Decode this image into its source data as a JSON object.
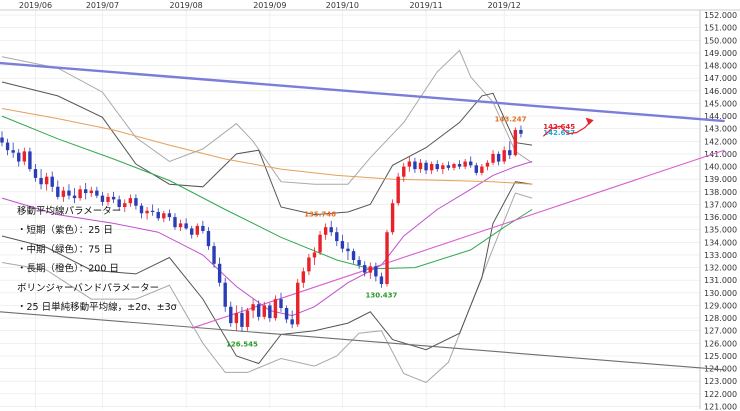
{
  "chart_data": {
    "type": "candlestick",
    "x_ticks": [
      "2019/06",
      "2019/07",
      "2019/08",
      "2019/09",
      "2019/10",
      "2019/11",
      "2019/12"
    ],
    "y_ticks": [
      121,
      122,
      123,
      124,
      125,
      126,
      127,
      128,
      129,
      130,
      131,
      132,
      133,
      134,
      135,
      136,
      137,
      138,
      139,
      140,
      141,
      142,
      143,
      144,
      145,
      146,
      147,
      148,
      149,
      150,
      151,
      152
    ],
    "y_tick_labels": [
      "121.000",
      "122.000",
      "123.000",
      "124.000",
      "125.000",
      "126.000",
      "127.000",
      "128.000",
      "129.000",
      "130.000",
      "131.000",
      "132.000",
      "133.000",
      "134.000",
      "135.000",
      "136.000",
      "137.000",
      "138.000",
      "139.000",
      "140.000",
      "141.000",
      "142.000",
      "143.000",
      "144.000",
      "145.000",
      "146.000",
      "147.000",
      "148.000",
      "149.000",
      "150.000",
      "151.000",
      "152.000"
    ],
    "ylim": [
      120.8,
      152.4
    ],
    "y_axis_side": "right",
    "grid": true,
    "up_color": "#e8212b",
    "down_color": "#2a3db5",
    "candles": [
      [
        142.3,
        142.8,
        141.6,
        141.9
      ],
      [
        141.9,
        142.2,
        140.9,
        141.3
      ],
      [
        141.3,
        141.9,
        140.7,
        141.1
      ],
      [
        141.1,
        141.4,
        140.0,
        140.4
      ],
      [
        140.4,
        141.5,
        140.1,
        141.2
      ],
      [
        141.2,
        141.5,
        139.6,
        139.8
      ],
      [
        139.8,
        140.2,
        138.8,
        139.1
      ],
      [
        139.1,
        139.8,
        138.2,
        138.6
      ],
      [
        138.6,
        139.5,
        138.1,
        139.2
      ],
      [
        139.2,
        139.6,
        138.0,
        138.4
      ],
      [
        138.4,
        138.9,
        137.4,
        137.6
      ],
      [
        137.6,
        138.4,
        137.2,
        138.1
      ],
      [
        138.1,
        138.6,
        137.4,
        137.7
      ],
      [
        137.7,
        138.3,
        137.1,
        137.5
      ],
      [
        137.5,
        138.5,
        137.3,
        138.2
      ],
      [
        138.2,
        138.7,
        137.4,
        137.9
      ],
      [
        137.9,
        138.4,
        137.6,
        138.1
      ],
      [
        138.1,
        138.4,
        137.5,
        137.7
      ],
      [
        137.7,
        138.0,
        136.9,
        137.2
      ],
      [
        137.2,
        137.9,
        136.9,
        137.6
      ],
      [
        137.6,
        138.0,
        137.1,
        137.4
      ],
      [
        137.4,
        137.7,
        136.5,
        136.8
      ],
      [
        136.8,
        137.4,
        136.4,
        137.1
      ],
      [
        137.1,
        137.8,
        136.8,
        137.5
      ],
      [
        137.5,
        137.8,
        136.6,
        136.9
      ],
      [
        136.9,
        137.1,
        135.9,
        136.3
      ],
      [
        136.3,
        136.8,
        135.8,
        136.5
      ],
      [
        136.5,
        137.0,
        136.1,
        136.4
      ],
      [
        136.4,
        136.7,
        135.7,
        135.9
      ],
      [
        135.9,
        136.5,
        135.6,
        136.3
      ],
      [
        136.3,
        136.6,
        135.7,
        136.0
      ],
      [
        136.0,
        136.3,
        135.0,
        135.2
      ],
      [
        135.2,
        135.8,
        134.9,
        135.5
      ],
      [
        135.5,
        135.9,
        135.0,
        135.1
      ],
      [
        135.1,
        135.3,
        134.3,
        134.6
      ],
      [
        134.6,
        135.5,
        134.4,
        135.3
      ],
      [
        135.3,
        135.7,
        134.7,
        134.9
      ],
      [
        134.9,
        135.2,
        133.4,
        133.7
      ],
      [
        133.7,
        134.0,
        132.0,
        132.3
      ],
      [
        132.3,
        132.8,
        130.5,
        130.8
      ],
      [
        130.8,
        131.2,
        128.5,
        128.9
      ],
      [
        128.9,
        129.3,
        127.3,
        127.6
      ],
      [
        127.6,
        129.0,
        127.0,
        128.4
      ],
      [
        128.4,
        128.9,
        126.9,
        127.3
      ],
      [
        127.3,
        128.8,
        127.0,
        128.6
      ],
      [
        128.6,
        129.5,
        128.0,
        129.1
      ],
      [
        129.1,
        129.4,
        127.8,
        128.1
      ],
      [
        128.1,
        129.3,
        127.9,
        129.0
      ],
      [
        129.0,
        129.2,
        127.7,
        128.0
      ],
      [
        128.0,
        129.8,
        127.8,
        129.5
      ],
      [
        129.5,
        130.0,
        128.5,
        128.8
      ],
      [
        128.8,
        129.0,
        127.6,
        127.9
      ],
      [
        127.9,
        128.6,
        127.2,
        127.5
      ],
      [
        127.5,
        131.1,
        127.3,
        130.8
      ],
      [
        130.8,
        132.0,
        130.4,
        131.7
      ],
      [
        131.7,
        133.1,
        131.4,
        132.8
      ],
      [
        132.8,
        133.6,
        132.2,
        133.2
      ],
      [
        133.2,
        134.9,
        133.0,
        134.6
      ],
      [
        134.6,
        135.5,
        134.2,
        135.2
      ],
      [
        135.2,
        135.7,
        134.5,
        134.8
      ],
      [
        134.8,
        135.2,
        133.7,
        134.1
      ],
      [
        134.1,
        134.6,
        133.2,
        133.5
      ],
      [
        133.5,
        134.0,
        132.6,
        133.3
      ],
      [
        133.3,
        133.5,
        132.3,
        132.6
      ],
      [
        132.6,
        132.9,
        131.9,
        132.2
      ],
      [
        132.2,
        132.5,
        131.3,
        131.6
      ],
      [
        131.6,
        132.4,
        131.1,
        132.1
      ],
      [
        132.1,
        132.4,
        130.9,
        131.3
      ],
      [
        131.3,
        131.6,
        130.4,
        130.7
      ],
      [
        130.7,
        135.0,
        130.5,
        134.8
      ],
      [
        134.8,
        137.4,
        134.6,
        137.1
      ],
      [
        137.1,
        139.5,
        136.9,
        139.2
      ],
      [
        139.2,
        140.3,
        138.8,
        140.0
      ],
      [
        140.0,
        140.8,
        139.6,
        140.4
      ],
      [
        140.4,
        140.7,
        139.5,
        139.8
      ],
      [
        139.8,
        140.6,
        139.5,
        140.3
      ],
      [
        140.3,
        140.5,
        139.4,
        139.7
      ],
      [
        139.7,
        140.4,
        139.4,
        140.2
      ],
      [
        140.2,
        140.5,
        139.6,
        139.8
      ],
      [
        139.8,
        140.3,
        139.4,
        140.1
      ],
      [
        140.1,
        140.4,
        139.7,
        139.9
      ],
      [
        139.9,
        140.3,
        139.7,
        140.2
      ],
      [
        140.2,
        140.5,
        139.8,
        140.0
      ],
      [
        140.0,
        140.6,
        139.8,
        140.4
      ],
      [
        140.4,
        140.8,
        139.9,
        140.1
      ],
      [
        140.1,
        140.3,
        139.3,
        139.5
      ],
      [
        139.5,
        140.2,
        139.3,
        140.0
      ],
      [
        140.0,
        140.5,
        139.7,
        140.3
      ],
      [
        140.3,
        141.3,
        140.1,
        141.0
      ],
      [
        141.0,
        141.2,
        140.1,
        140.4
      ],
      [
        140.4,
        141.6,
        140.2,
        141.3
      ],
      [
        141.3,
        142.0,
        140.6,
        140.9
      ],
      [
        140.9,
        143.1,
        140.8,
        142.9
      ],
      [
        142.9,
        143.25,
        142.3,
        142.6
      ]
    ],
    "moving_averages": [
      {
        "color": "#c050d0",
        "points": [
          [
            0,
            137.5
          ],
          [
            10,
            136.2
          ],
          [
            20,
            135.5
          ],
          [
            28,
            134.8
          ],
          [
            36,
            133.0
          ],
          [
            42,
            130.5
          ],
          [
            48,
            128.6
          ],
          [
            52,
            128.2
          ],
          [
            56,
            128.9
          ],
          [
            62,
            130.8
          ],
          [
            68,
            132.2
          ],
          [
            72,
            134.5
          ],
          [
            78,
            136.6
          ],
          [
            84,
            138.2
          ],
          [
            88,
            139.3
          ],
          [
            92,
            140.0
          ],
          [
            95,
            140.4
          ]
        ]
      },
      {
        "color": "#2fa84f",
        "points": [
          [
            0,
            144.0
          ],
          [
            10,
            142.2
          ],
          [
            20,
            140.6
          ],
          [
            30,
            138.9
          ],
          [
            40,
            136.6
          ],
          [
            50,
            134.4
          ],
          [
            60,
            132.6
          ],
          [
            66,
            131.9
          ],
          [
            74,
            132.0
          ],
          [
            84,
            133.4
          ],
          [
            90,
            135.2
          ],
          [
            95,
            136.6
          ]
        ]
      },
      {
        "color": "#e5a058",
        "points": [
          [
            0,
            144.6
          ],
          [
            10,
            143.8
          ],
          [
            20,
            142.9
          ],
          [
            30,
            141.7
          ],
          [
            40,
            140.6
          ],
          [
            50,
            139.8
          ],
          [
            60,
            139.3
          ],
          [
            70,
            139.0
          ],
          [
            80,
            138.9
          ],
          [
            88,
            138.8
          ],
          [
            95,
            138.6
          ]
        ]
      }
    ],
    "bollinger_bands": [
      {
        "sigma": "±2σ",
        "color": "#555555",
        "upper": [
          [
            0,
            146.7
          ],
          [
            10,
            145.6
          ],
          [
            18,
            143.9
          ],
          [
            24,
            140.2
          ],
          [
            30,
            138.6
          ],
          [
            36,
            138.4
          ],
          [
            42,
            141.0
          ],
          [
            46,
            141.3
          ],
          [
            50,
            136.8
          ],
          [
            56,
            136.2
          ],
          [
            62,
            136.4
          ],
          [
            66,
            137.0
          ],
          [
            70,
            140.1
          ],
          [
            76,
            141.5
          ],
          [
            82,
            143.5
          ],
          [
            86,
            145.6
          ],
          [
            88,
            145.8
          ],
          [
            92,
            141.9
          ],
          [
            95,
            141.7
          ]
        ],
        "lower": [
          [
            0,
            134.5
          ],
          [
            8,
            133.6
          ],
          [
            16,
            131.8
          ],
          [
            24,
            131.5
          ],
          [
            30,
            132.8
          ],
          [
            36,
            129.5
          ],
          [
            42,
            125.0
          ],
          [
            46,
            124.4
          ],
          [
            50,
            126.7
          ],
          [
            56,
            127.0
          ],
          [
            62,
            127.6
          ],
          [
            66,
            128.5
          ],
          [
            70,
            126.3
          ],
          [
            76,
            125.5
          ],
          [
            82,
            126.8
          ],
          [
            86,
            131.2
          ],
          [
            88,
            135.5
          ],
          [
            92,
            138.8
          ],
          [
            95,
            138.6
          ]
        ]
      },
      {
        "sigma": "±3σ",
        "color": "#a8a8a8",
        "upper": [
          [
            0,
            148.7
          ],
          [
            10,
            147.8
          ],
          [
            18,
            145.9
          ],
          [
            24,
            142.3
          ],
          [
            30,
            140.4
          ],
          [
            36,
            141.4
          ],
          [
            42,
            143.4
          ],
          [
            45,
            142.0
          ],
          [
            50,
            138.8
          ],
          [
            56,
            138.6
          ],
          [
            62,
            138.6
          ],
          [
            66,
            140.7
          ],
          [
            72,
            143.5
          ],
          [
            78,
            147.5
          ],
          [
            82,
            149.2
          ],
          [
            84,
            147.1
          ],
          [
            88,
            145.1
          ],
          [
            92,
            141.2
          ],
          [
            95,
            140.3
          ]
        ],
        "lower": [
          [
            0,
            132.4
          ],
          [
            8,
            131.8
          ],
          [
            16,
            129.5
          ],
          [
            24,
            129.5
          ],
          [
            30,
            130.6
          ],
          [
            36,
            126.0
          ],
          [
            40,
            123.7
          ],
          [
            44,
            123.7
          ],
          [
            50,
            124.8
          ],
          [
            56,
            124.2
          ],
          [
            60,
            125.0
          ],
          [
            64,
            126.8
          ],
          [
            68,
            127.0
          ],
          [
            72,
            123.6
          ],
          [
            76,
            122.9
          ],
          [
            80,
            124.5
          ],
          [
            84,
            129.0
          ],
          [
            88,
            133.5
          ],
          [
            92,
            137.9
          ],
          [
            95,
            137.5
          ]
        ]
      }
    ],
    "trend_lines": [
      {
        "color": "#7b7ddb",
        "from": [
          -0.5,
          148.2
        ],
        "to": [
          129.5,
          143.6
        ],
        "width": 2.4
      },
      {
        "color": "#6e6e6e",
        "from": [
          -0.5,
          128.5
        ],
        "to": [
          129.5,
          123.9
        ],
        "width": 1.1
      },
      {
        "color": "#d860d0",
        "from": [
          34,
          127.2
        ],
        "to": [
          129.5,
          141.3
        ],
        "width": 1.1
      }
    ],
    "annotations": [
      {
        "text": "143.247",
        "at": [
          94,
          143.25
        ],
        "color": "#e07020",
        "anchor": "end"
      },
      {
        "text": "142.645",
        "at": [
          97,
          142.645
        ],
        "color": "#e8212b",
        "anchor": "start"
      },
      {
        "text": "142.637",
        "at": [
          97,
          142.2
        ],
        "color": "#1ea8d8",
        "anchor": "start"
      },
      {
        "text": "135.746",
        "at": [
          57,
          135.746
        ],
        "color": "#e07020",
        "anchor": "middle"
      },
      {
        "text": "130.437",
        "at": [
          68,
          130.437
        ],
        "color": "#2a9a2a",
        "anchor": "middle"
      },
      {
        "text": "126.545",
        "at": [
          43,
          126.545
        ],
        "color": "#2a9a2a",
        "anchor": "middle"
      }
    ],
    "legend": [
      "移動平均線パラメーター",
      "・短期（紫色）：25 日",
      "・中期（緑色）：75 日",
      "・長期（橙色）：200 日",
      "ボリンジャーバンドパラメーター",
      "・25 日単純移動平均線，±2σ、±3σ"
    ],
    "legend_placement": "left",
    "forecast_arrow": {
      "color": "#e8212b",
      "points": [
        [
          97,
          142.4
        ],
        [
          98.5,
          143.0
        ],
        [
          100,
          143.2
        ],
        [
          101.5,
          142.6
        ],
        [
          103,
          142.7
        ],
        [
          104.5,
          143.1
        ],
        [
          105.5,
          143.6
        ]
      ]
    }
  }
}
